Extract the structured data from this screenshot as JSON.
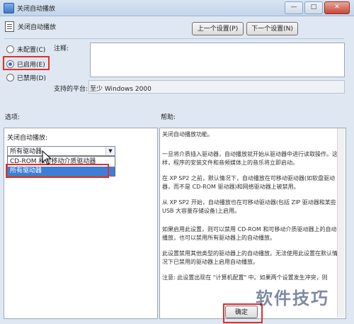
{
  "window": {
    "title": "关闭自动播放",
    "controls": [
      "—",
      "□",
      "✕"
    ]
  },
  "header": {
    "title": "关闭自动播放",
    "prev_label": "上一个设置(P)",
    "next_label": "下一个设置(N)"
  },
  "radios": [
    {
      "label": "未配置(C)",
      "checked": false
    },
    {
      "label": "已启用(E)",
      "checked": true
    },
    {
      "label": "已禁用(D)",
      "checked": false
    }
  ],
  "comment": {
    "label": "注释:",
    "value": ""
  },
  "platform": {
    "label": "支持的平台:",
    "value": "至少 Windows 2000"
  },
  "options": {
    "section_label": "选项:",
    "field_label": "关闭自动播放:",
    "selected": "所有驱动器",
    "dropdown_items": [
      "CD-ROM 和可移动介质驱动器",
      "所有驱动器"
    ]
  },
  "help": {
    "section_label": "帮助:",
    "paragraphs": [
      "关闭自动播放功能。",
      "一旦将介质插入驱动器，自动播放就开始从驱动器中进行读取操作。这样，程序的安装文件和音频媒体上的音乐将立即启动。",
      "在 XP SP2 之前，默认情况下，自动播放在可移动驱动器(如软盘驱动器，而不是 CD-ROM 驱动器)和网络驱动器上被禁用。",
      "从 XP SP2 开始，自动播放也在可移动驱动器(包括 ZIP 驱动器和某些 USB 大容量存储设备)上启用。",
      "如果启用此设置，则可以禁用 CD-ROM 和可移动介质驱动器上的自动播放，也可以禁用所有驱动器上的自动播放。",
      "此设置禁用其他类型的驱动器上的自动播放。无法使用此设置在默认情况下已禁用的驱动器上启用自动播放。",
      "注意: 此设置出现在 \"计算机配置\" 中。如果两个设置发生冲突，则"
    ]
  },
  "footer": {
    "ok_label": "确定"
  },
  "watermark": "软件技巧",
  "colors": {
    "highlight_box": "#e0302a",
    "selection": "#3c7fd6"
  }
}
